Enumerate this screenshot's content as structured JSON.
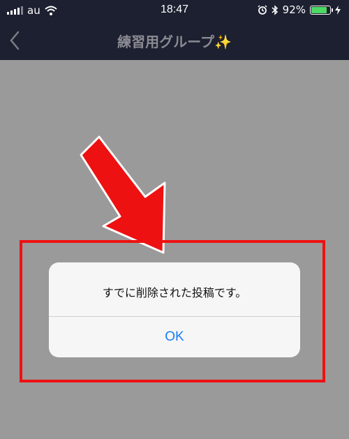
{
  "status_bar": {
    "carrier": "au",
    "time": "18:47",
    "battery_percent": "92%",
    "battery_level": 0.92,
    "icons": [
      "signal-icon",
      "wifi-icon",
      "alarm-icon",
      "bluetooth-icon",
      "battery-icon",
      "charging-icon"
    ]
  },
  "nav": {
    "title": "練習用グループ",
    "title_emoji": "✨",
    "back_icon": "chevron-left-icon"
  },
  "dialog": {
    "message": "すでに削除された投稿です。",
    "ok_label": "OK"
  },
  "annotation": {
    "color": "#ee1111",
    "icon": "arrow-down-right-icon"
  },
  "colors": {
    "bar_background": "#1c2030",
    "overlay": "#9a9a9a",
    "dialog_button": "#1a7cf0",
    "battery": "#4cd964"
  }
}
